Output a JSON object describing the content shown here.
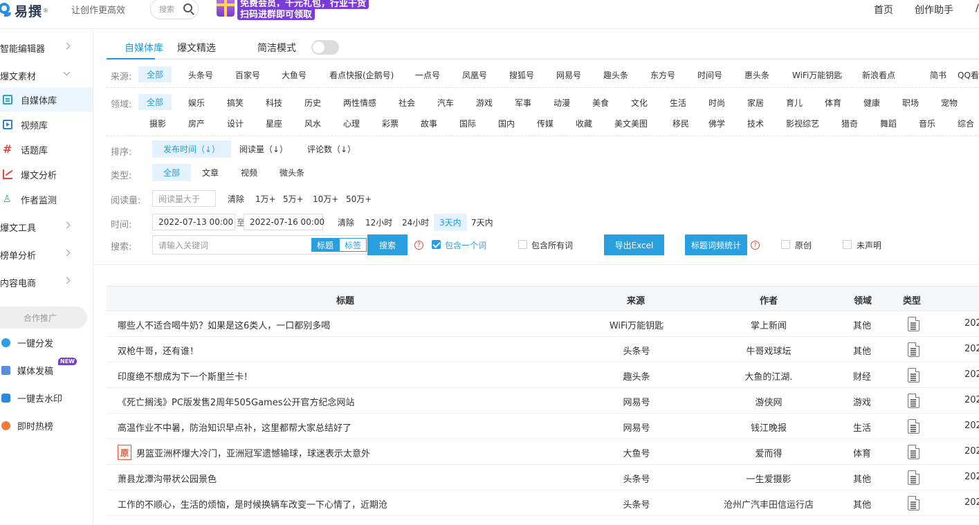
{
  "header": {
    "logo_text": "易撰",
    "logo_sup": "®",
    "slogan": "让创作更高效",
    "search_placeholder": "搜索",
    "promo_line1": "免费会员，千元礼包，行业干货",
    "promo_line2": "扫码进群即可领取",
    "nav": [
      "首页",
      "创作助手",
      "/"
    ]
  },
  "sidebar": {
    "groups": {
      "smart_editor": "智能编辑器",
      "material": "爆文素材",
      "tools": "爆文工具",
      "ranking": "榜单分析",
      "ecommerce": "内容电商"
    },
    "items": [
      "自媒体库",
      "视频库",
      "话题库",
      "爆文分析",
      "作者监测"
    ],
    "coop_label": "合作推广",
    "coop_items": [
      "一键分发",
      "媒体发稿",
      "一键去水印",
      "即时热榜"
    ],
    "new_badge": "NEW"
  },
  "tabs": {
    "items": [
      "自媒体库",
      "爆文精选"
    ],
    "simple_mode": "简洁模式"
  },
  "filters": {
    "source_label": "来源:",
    "sources": [
      "全部",
      "头条号",
      "百家号",
      "大鱼号",
      "看点快报(企鹅号)",
      "一点号",
      "凤凰号",
      "搜狐号",
      "网易号",
      "趣头条",
      "东方号",
      "时间号",
      "惠头条",
      "WiFi万能钥匙",
      "新浪看点",
      "简书",
      "QQ看"
    ],
    "domain_label": "领域:",
    "domains_row1": [
      "全部",
      "娱乐",
      "搞笑",
      "科技",
      "历史",
      "两性情感",
      "社会",
      "汽车",
      "游戏",
      "军事",
      "动漫",
      "美食",
      "文化",
      "生活",
      "时尚",
      "家居",
      "育儿",
      "体育",
      "健康",
      "职场",
      "宠物"
    ],
    "domains_row2": [
      "摄影",
      "房产",
      "设计",
      "星座",
      "风水",
      "心理",
      "彩票",
      "故事",
      "国际",
      "国内",
      "传媒",
      "收藏",
      "美文美图",
      "移民",
      "佛学",
      "技术",
      "影视综艺",
      "猎奇",
      "舞蹈",
      "音乐",
      "综合"
    ],
    "sort_label": "排序:",
    "sorts": [
      "发布时间（↓）",
      "阅读量（↓）",
      "评论数（↓）"
    ],
    "type_label": "类型:",
    "types": [
      "全部",
      "文章",
      "视频",
      "微头条"
    ],
    "read_label": "阅读量:",
    "read_placeholder": "阅读量大于",
    "read_options": [
      "清除",
      "1万+",
      "5万+",
      "10万+",
      "50万+"
    ],
    "time_label": "时间:",
    "date_start": "2022-07-13 00:00",
    "date_sep": "至",
    "date_end": "2022-07-16 00:00",
    "time_options": [
      "清除",
      "12小时",
      "24小时",
      "3天内",
      "7天内"
    ],
    "search_label": "搜索:",
    "search_placeholder": "请输入关键词",
    "seg_title": "标题",
    "seg_tag": "标签",
    "search_button": "搜索",
    "q_mark": "?",
    "contains_one": "包含一个词",
    "contains_all": "包含所有词",
    "export_button": "导出Excel",
    "stats_button": "标题词频统计",
    "original": "原创",
    "undeclared": "未声明"
  },
  "table": {
    "headers": [
      "标题",
      "来源",
      "作者",
      "领域",
      "类型"
    ],
    "original_badge": "原",
    "rows": [
      {
        "title": "哪些人不适合喝牛奶？如果是这6类人，一口都别多喝",
        "source": "WiFi万能钥匙",
        "author": "掌上新闻",
        "domain": "其他",
        "date": "202",
        "original": false
      },
      {
        "title": "双枪牛哥，还有谁！",
        "source": "头条号",
        "author": "牛哥戏球坛",
        "domain": "其他",
        "date": "202",
        "original": false
      },
      {
        "title": "印度绝不想成为下一个斯里兰卡！",
        "source": "趣头条",
        "author": "大鱼的江湖.",
        "domain": "财经",
        "date": "202",
        "original": false
      },
      {
        "title": "《死亡搁浅》PC版发售2周年505Games公开官方纪念网站",
        "source": "网易号",
        "author": "游侠网",
        "domain": "游戏",
        "date": "202",
        "original": false
      },
      {
        "title": "高温作业不中暑，防治知识早点补，这里都帮大家总结好了",
        "source": "网易号",
        "author": "钱江晚报",
        "domain": "生活",
        "date": "202",
        "original": false
      },
      {
        "title": "男篮亚洲杯爆大冷门，亚洲冠军遗憾输球，球迷表示太意外",
        "source": "大鱼号",
        "author": "爱而得",
        "domain": "体育",
        "date": "202",
        "original": true
      },
      {
        "title": "萧县龙潭沟带状公园景色",
        "source": "头条号",
        "author": "一生爱摄影",
        "domain": "其他",
        "date": "202",
        "original": false
      },
      {
        "title": "工作的不顺心，生活的烦恼，是时候换辆车改变一下心情了，近期沧",
        "source": "头条号",
        "author": "沧州广汽丰田信运行店",
        "domain": "其他",
        "date": "202",
        "original": false
      }
    ]
  }
}
